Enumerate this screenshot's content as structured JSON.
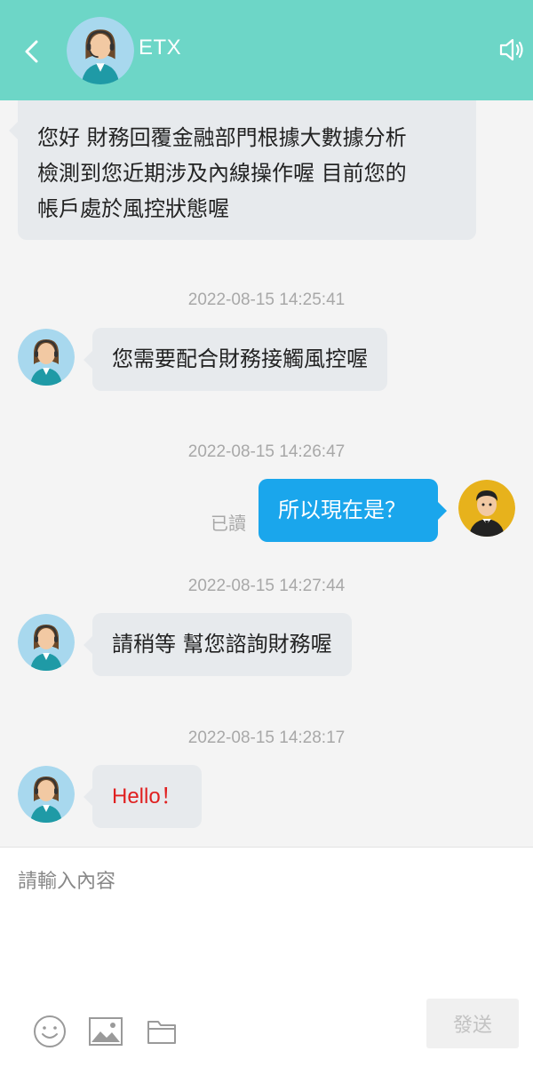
{
  "header": {
    "title": "ETX",
    "accent_color": "#6dd6c7",
    "back_icon": "chevron-left-icon",
    "speaker_icon": "speaker-icon"
  },
  "messages": [
    {
      "side": "agent",
      "lines": [
        "您好 財務回覆金融部門根據大數據分析",
        "檢測到您近期涉及內線操作喔 目前您的",
        "帳戶處於風控狀態喔"
      ]
    },
    {
      "timestamp": "2022-08-15 14:25:41"
    },
    {
      "side": "agent",
      "text": "您需要配合財務接觸風控喔"
    },
    {
      "timestamp": "2022-08-15 14:26:47"
    },
    {
      "side": "user",
      "text": "所以現在是？",
      "status": "已讀"
    },
    {
      "timestamp": "2022-08-15 14:27:44"
    },
    {
      "side": "agent",
      "text": "請稍等 幫您諮詢財務喔"
    },
    {
      "timestamp": "2022-08-15 14:28:17"
    },
    {
      "side": "agent",
      "text": "Hello！",
      "color": "#e02020"
    }
  ],
  "composer": {
    "placeholder": "請輸入內容",
    "send_label": "發送",
    "icons": [
      "emoji-icon",
      "image-icon",
      "folder-icon"
    ]
  }
}
